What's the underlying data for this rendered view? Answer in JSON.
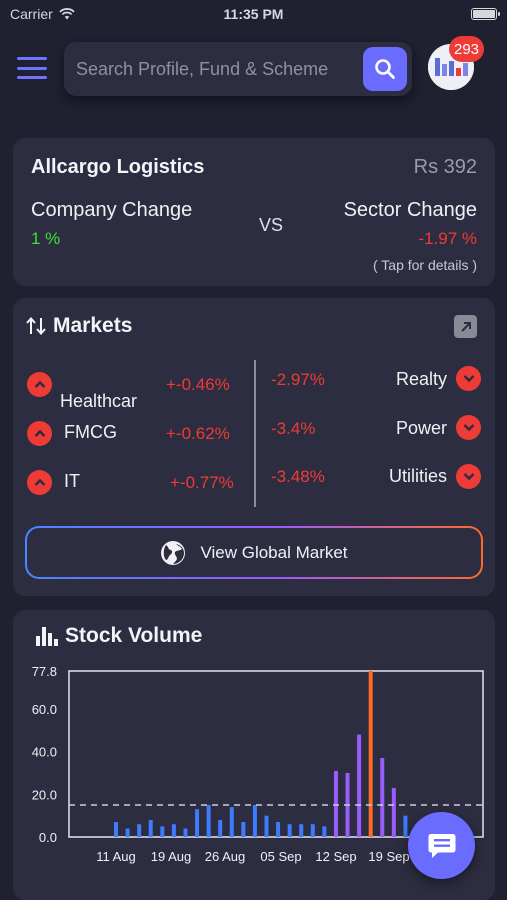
{
  "status": {
    "carrier": "Carrier",
    "time": "11:35 PM"
  },
  "header": {
    "search_placeholder": "Search Profile, Fund & Scheme",
    "notification_count": "293"
  },
  "company_card": {
    "name": "Allcargo Logistics",
    "price": "Rs 392",
    "company_change_label": "Company Change",
    "company_change_value": "1 %",
    "vs_label": "VS",
    "sector_change_label": "Sector Change",
    "sector_change_value": "-1.97 %",
    "tap_hint": "( Tap for details )"
  },
  "markets": {
    "title": "Markets",
    "left": [
      {
        "sector": "Healthcar",
        "change": "+-0.46%"
      },
      {
        "sector": "FMCG",
        "change": "+-0.62%"
      },
      {
        "sector": "IT",
        "change": "+-0.77%"
      }
    ],
    "right": [
      {
        "sector": "Realty",
        "change": "-2.97%"
      },
      {
        "sector": "Power",
        "change": "-3.4%"
      },
      {
        "sector": "Utilities",
        "change": "-3.48%"
      }
    ],
    "global_button_label": "View Global Market"
  },
  "stock_volume": {
    "title": "Stock Volume",
    "chart_data": {
      "type": "bar",
      "y_ticks": [
        "77.8",
        "60.0",
        "40.0",
        "20.0",
        "0.0"
      ],
      "ylim": [
        0,
        77.8
      ],
      "x_tick_labels": [
        "11 Aug",
        "19 Aug",
        "26 Aug",
        "05 Sep",
        "12 Sep",
        "19 Sep"
      ],
      "reference_line": 15,
      "values": [
        7,
        4,
        6,
        8,
        5,
        6,
        4,
        13,
        15,
        8,
        14,
        7,
        15,
        10,
        7,
        6,
        6,
        6,
        5,
        31,
        30,
        48,
        77.8,
        37,
        23,
        10,
        6
      ],
      "colors": {
        "low": "#3e7bff",
        "mid": "#9a5cff",
        "peak": "#ff6a2b"
      }
    }
  }
}
